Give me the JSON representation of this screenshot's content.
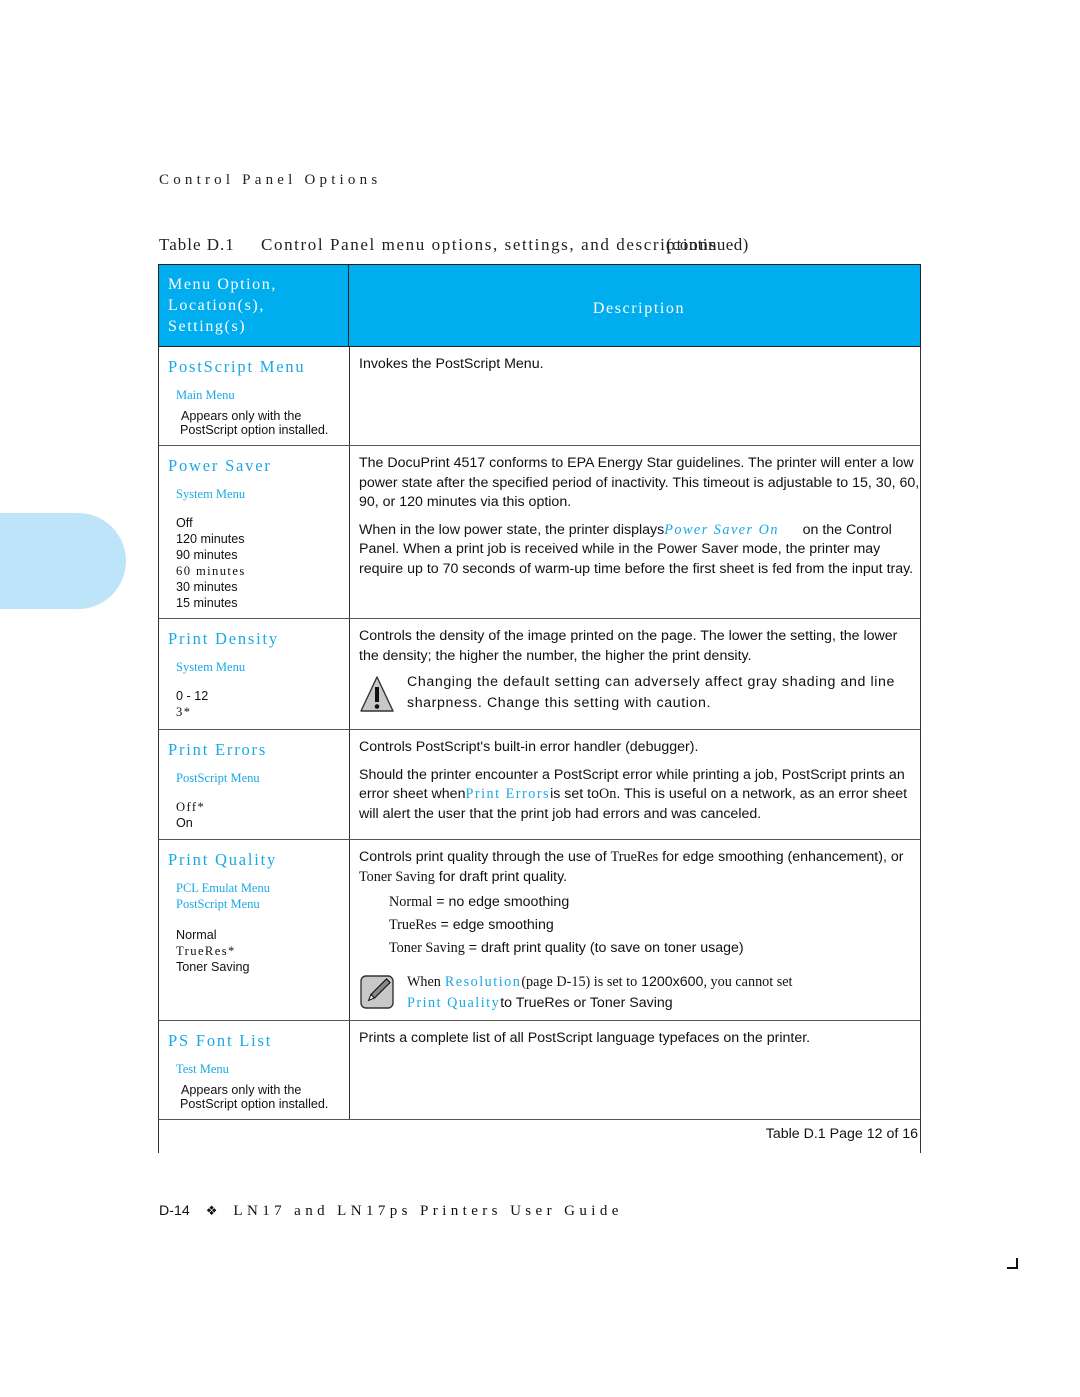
{
  "running_head": "Control Panel Options",
  "table_title": {
    "label": "Table D.1",
    "caption": "Control Panel menu options, settings, and descriptions",
    "continued": "(continued)"
  },
  "header": {
    "col1_lines": [
      "Menu Option,",
      "Location(s),",
      "Setting(s)"
    ],
    "col2": "Description"
  },
  "rows": [
    {
      "name": "PostScript Menu",
      "locations": [
        "Main Menu"
      ],
      "settings": [],
      "note": [
        "Appears only with the",
        "PostScript option installed."
      ],
      "description": [
        "Invokes the PostScript Menu."
      ]
    },
    {
      "name": "Power Saver",
      "locations": [
        "System Menu"
      ],
      "settings": [
        "Off",
        "120 minutes",
        "90 minutes",
        "60 minutes",
        "30 minutes",
        "15 minutes"
      ],
      "default_setting": "60 minutes",
      "description": [
        "The DocuPrint 4517 conforms to EPA Energy Star guidelines. The printer will enter a low power state after the specified period of inactivity. This timeout is adjustable to 15, 30, 60, 90, or 120 minutes via this option."
      ],
      "desc2_pre": "When in the low power state, the printer displays",
      "desc2_code": "Power Saver On",
      "desc2_post": "on the Control Panel. When a print job is received while in the Power Saver mode, the printer may require up to 70 seconds of warm-up time before the first sheet is fed from the input tray."
    },
    {
      "name": "Print Density",
      "locations": [
        "System Menu"
      ],
      "settings": [
        "0 - 12",
        "3*"
      ],
      "description": [
        "Controls the density of the image printed on the page. The lower the setting, the lower the density; the higher the number, the higher the print density."
      ],
      "caution_icon": "warning-triangle-icon",
      "caution": "Changing the default setting can adversely affect gray shading and line sharpness. Change this setting with caution."
    },
    {
      "name": "Print Errors",
      "locations": [
        "PostScript Menu"
      ],
      "settings": [
        "Off*",
        "On"
      ],
      "description": [
        "Controls PostScript's built-in error handler (debugger)."
      ],
      "desc2_pre": "Should the printer encounter a PostScript error while printing a job, PostScript prints an error sheet when",
      "desc2_code": "Print Errors",
      "desc2_mid": "is set to",
      "desc2_val": "On",
      "desc2_post": ". This is useful on a network, as an error sheet will alert the user that the print job had errors and was canceled."
    },
    {
      "name": "Print Quality",
      "locations": [
        "PCL Emulat Menu",
        "PostScript Menu"
      ],
      "settings": [
        "Normal",
        "TrueRes*",
        "Toner Saving"
      ],
      "desc_pre": "Controls print quality through the use of",
      "desc_term1": "TrueRes",
      "desc_mid": "for edge smoothing (enhancement), or",
      "desc_term2": "Toner Saving",
      "desc_post": "for draft print quality.",
      "list": [
        {
          "term": "Normal",
          "def": "= no edge smoothing"
        },
        {
          "term": "TrueRes",
          "def": "= edge smoothing"
        },
        {
          "term": "Toner Saving",
          "def": "= draft print quality (to save on toner usage)"
        }
      ],
      "note_icon": "pencil-note-icon",
      "note_pre": "When",
      "note_link": "Resolution",
      "note_ref": "(page D-15) is set to",
      "note_val": "1200x600",
      "note_mid": ", you cannot set",
      "note_code": "Print Quality",
      "note_post": "to TrueRes or Toner Saving"
    },
    {
      "name": "PS Font List",
      "locations": [
        "Test Menu"
      ],
      "settings": [],
      "note": [
        "Appears only with the",
        "PostScript option installed."
      ],
      "description": [
        "Prints a complete list of all PostScript language typefaces on the printer."
      ]
    }
  ],
  "table_page": "Table D.1  Page 12 of 16",
  "footer": {
    "page_number": "D-14",
    "separator": "❖",
    "guide_title": "LN17 and LN17ps Printers User Guide"
  }
}
